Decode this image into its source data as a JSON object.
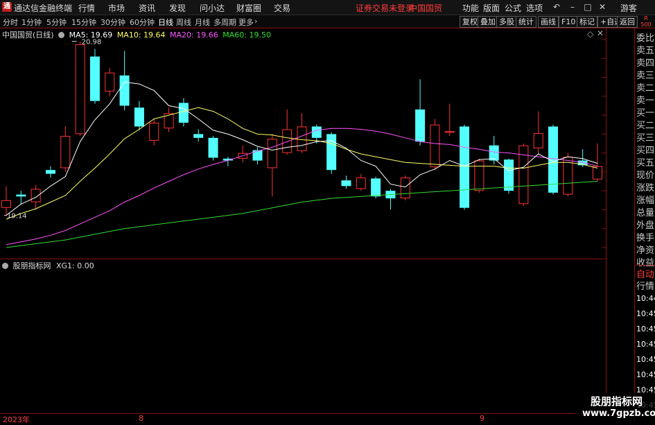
{
  "titlebar": {
    "app_name": "通达信金融终端",
    "menu": [
      "行情",
      "市场",
      "资讯",
      "发现",
      "问小达",
      "财富圈",
      "交易"
    ],
    "notice": "证券交易未登录",
    "stock_name": "中国国贸",
    "right_menu": [
      "功能",
      "版面",
      "公式",
      "选项"
    ],
    "guest": "游客"
  },
  "toolbar": {
    "periods": [
      "分时",
      "1分钟",
      "5分钟",
      "15分钟",
      "30分钟",
      "60分钟",
      "日线",
      "周线",
      "月线",
      "多周期",
      "更多"
    ],
    "selected_period": "日线",
    "right_buttons": [
      "复权",
      "叠加",
      "多股",
      "统计",
      "画线",
      "F10",
      "标记",
      "+自选",
      "返回"
    ],
    "corner": "R 500"
  },
  "main_chart": {
    "stock_label": "中国国贸(日线)",
    "ma": [
      {
        "label": "MA5: 19.69",
        "color": "#ffffff"
      },
      {
        "label": "MA10: 19.64",
        "color": "#ffff66"
      },
      {
        "label": "MA20: 19.66",
        "color": "#ff55ff"
      },
      {
        "label": "MA60: 19.50",
        "color": "#33dd33"
      }
    ],
    "high_marker": "20.98",
    "low_marker": "19.14"
  },
  "sub_chart": {
    "label": "股朋指标网",
    "value": "XG1: 0.00"
  },
  "date_axis": {
    "year": "2023年",
    "month_a": "8",
    "month_b": "9"
  },
  "right_panel": {
    "items": [
      "委比",
      "卖五",
      "卖四",
      "卖三",
      "卖二",
      "卖一",
      "买一",
      "买二",
      "买三",
      "买四",
      "买五",
      "现价",
      "涨跌",
      "涨幅",
      "总量",
      "外盘",
      "换手",
      "净资",
      "收益"
    ],
    "tab_auto": "自动",
    "tab_quote": "行情",
    "times": [
      "10:44",
      "10:45",
      "10:45",
      "10:45",
      "10:45",
      "10:45",
      "10:45",
      "10:45"
    ]
  },
  "watermark": {
    "name": "股朋指标网",
    "site": "www.7gpzb.com"
  },
  "chart_data": {
    "type": "candlestick",
    "y_ticks": [
      "21.00",
      "20.80",
      "20.60",
      "20.40",
      "20.20",
      "20.00",
      "19.80",
      "19.60",
      "19.40",
      "19.20",
      "19.00",
      "18.80"
    ],
    "ylim": [
      18.7,
      21.15
    ],
    "candles": [
      {
        "o": 19.22,
        "c": 19.3,
        "h": 19.45,
        "l": 19.14
      },
      {
        "o": 19.36,
        "c": 19.34,
        "h": 19.4,
        "l": 19.26
      },
      {
        "o": 19.28,
        "c": 19.42,
        "h": 19.46,
        "l": 19.2
      },
      {
        "o": 19.62,
        "c": 19.58,
        "h": 19.66,
        "l": 19.54
      },
      {
        "o": 19.64,
        "c": 19.98,
        "h": 20.08,
        "l": 19.6
      },
      {
        "o": 20.0,
        "c": 20.95,
        "h": 20.98,
        "l": 19.98
      },
      {
        "o": 20.82,
        "c": 20.35,
        "h": 20.9,
        "l": 20.32
      },
      {
        "o": 20.45,
        "c": 20.65,
        "h": 20.7,
        "l": 20.4
      },
      {
        "o": 20.62,
        "c": 20.3,
        "h": 20.88,
        "l": 20.25
      },
      {
        "o": 20.28,
        "c": 20.08,
        "h": 20.35,
        "l": 20.04
      },
      {
        "o": 19.93,
        "c": 20.12,
        "h": 20.16,
        "l": 19.88
      },
      {
        "o": 20.06,
        "c": 20.22,
        "h": 20.28,
        "l": 20.02
      },
      {
        "o": 20.33,
        "c": 20.12,
        "h": 20.38,
        "l": 20.08
      },
      {
        "o": 20.0,
        "c": 19.96,
        "h": 20.05,
        "l": 19.92
      },
      {
        "o": 19.96,
        "c": 19.75,
        "h": 19.98,
        "l": 19.72
      },
      {
        "o": 19.74,
        "c": 19.72,
        "h": 19.76,
        "l": 19.66
      },
      {
        "o": 19.74,
        "c": 19.8,
        "h": 19.88,
        "l": 19.7
      },
      {
        "o": 19.83,
        "c": 19.72,
        "h": 19.86,
        "l": 19.68
      },
      {
        "o": 19.64,
        "c": 19.95,
        "h": 20.0,
        "l": 19.34
      },
      {
        "o": 19.8,
        "c": 20.05,
        "h": 20.26,
        "l": 19.78
      },
      {
        "o": 19.82,
        "c": 20.08,
        "h": 20.22,
        "l": 19.8
      },
      {
        "o": 20.08,
        "c": 19.96,
        "h": 20.1,
        "l": 19.9
      },
      {
        "o": 20.0,
        "c": 19.62,
        "h": 20.02,
        "l": 19.58
      },
      {
        "o": 19.51,
        "c": 19.45,
        "h": 19.56,
        "l": 19.42
      },
      {
        "o": 19.42,
        "c": 19.54,
        "h": 19.58,
        "l": 19.4
      },
      {
        "o": 19.53,
        "c": 19.34,
        "h": 19.55,
        "l": 19.32
      },
      {
        "o": 19.4,
        "c": 19.32,
        "h": 19.42,
        "l": 19.2
      },
      {
        "o": 19.32,
        "c": 19.54,
        "h": 19.56,
        "l": 19.3
      },
      {
        "o": 20.26,
        "c": 19.92,
        "h": 20.58,
        "l": 19.88
      },
      {
        "o": 19.65,
        "c": 20.1,
        "h": 20.16,
        "l": 19.62
      },
      {
        "o": 20.02,
        "c": 20.03,
        "h": 20.32,
        "l": 19.98
      },
      {
        "o": 20.08,
        "c": 19.22,
        "h": 20.1,
        "l": 19.2
      },
      {
        "o": 19.4,
        "c": 19.72,
        "h": 19.74,
        "l": 19.38
      },
      {
        "o": 19.88,
        "c": 19.72,
        "h": 19.98,
        "l": 19.68
      },
      {
        "o": 19.73,
        "c": 19.4,
        "h": 19.74,
        "l": 19.37
      },
      {
        "o": 19.26,
        "c": 19.88,
        "h": 19.9,
        "l": 19.24
      },
      {
        "o": 19.85,
        "c": 20.01,
        "h": 20.24,
        "l": 19.79
      },
      {
        "o": 20.08,
        "c": 19.38,
        "h": 20.1,
        "l": 19.36
      },
      {
        "o": 19.36,
        "c": 19.76,
        "h": 19.8,
        "l": 19.34
      },
      {
        "o": 19.72,
        "c": 19.67,
        "h": 19.84,
        "l": 19.65
      },
      {
        "o": 19.52,
        "c": 19.66,
        "h": 19.9,
        "l": 19.5
      }
    ],
    "ma5": [
      19.14,
      19.26,
      19.33,
      19.45,
      19.55,
      19.92,
      20.15,
      20.32,
      20.55,
      20.53,
      20.46,
      20.3,
      20.27,
      20.16,
      20.04,
      20.0,
      19.94,
      19.87,
      19.83,
      19.86,
      19.88,
      19.92,
      19.93,
      19.85,
      19.72,
      19.66,
      19.47,
      19.44,
      19.57,
      19.63,
      19.72,
      19.66,
      19.73,
      19.74,
      19.61,
      19.65,
      19.79,
      19.71,
      19.76,
      19.74,
      19.69
    ],
    "ma10": [
      19.1,
      19.16,
      19.21,
      19.28,
      19.35,
      19.5,
      19.64,
      19.79,
      19.95,
      20.05,
      20.16,
      20.2,
      20.24,
      20.28,
      20.24,
      20.16,
      20.06,
      20.0,
      19.99,
      19.96,
      19.94,
      19.93,
      19.9,
      19.84,
      19.79,
      19.76,
      19.73,
      19.7,
      19.69,
      19.68,
      19.67,
      19.66,
      19.66,
      19.66,
      19.64,
      19.64,
      19.67,
      19.7,
      19.7,
      19.68,
      19.64
    ],
    "ma20": [
      18.83,
      18.86,
      18.89,
      18.93,
      18.98,
      19.05,
      19.12,
      19.19,
      19.28,
      19.35,
      19.43,
      19.5,
      19.57,
      19.63,
      19.68,
      19.72,
      19.77,
      19.82,
      19.86,
      19.92,
      19.98,
      20.04,
      20.06,
      20.06,
      20.05,
      20.03,
      20.0,
      19.96,
      19.92,
      19.9,
      19.89,
      19.86,
      19.84,
      19.81,
      19.8,
      19.78,
      19.76,
      19.74,
      19.72,
      19.7,
      19.66
    ],
    "ma60": [
      18.8,
      18.82,
      18.84,
      18.86,
      18.88,
      18.91,
      18.94,
      18.97,
      19.0,
      19.02,
      19.04,
      19.06,
      19.08,
      19.1,
      19.12,
      19.14,
      19.16,
      19.19,
      19.22,
      19.25,
      19.28,
      19.3,
      19.32,
      19.33,
      19.34,
      19.35,
      19.36,
      19.37,
      19.38,
      19.39,
      19.4,
      19.41,
      19.42,
      19.43,
      19.44,
      19.45,
      19.46,
      19.47,
      19.48,
      19.49,
      19.5
    ]
  },
  "colors": {
    "up": "#ff3333",
    "down": "#54ffff",
    "axis": "#8a1010",
    "grid": "#5a0a0a"
  }
}
